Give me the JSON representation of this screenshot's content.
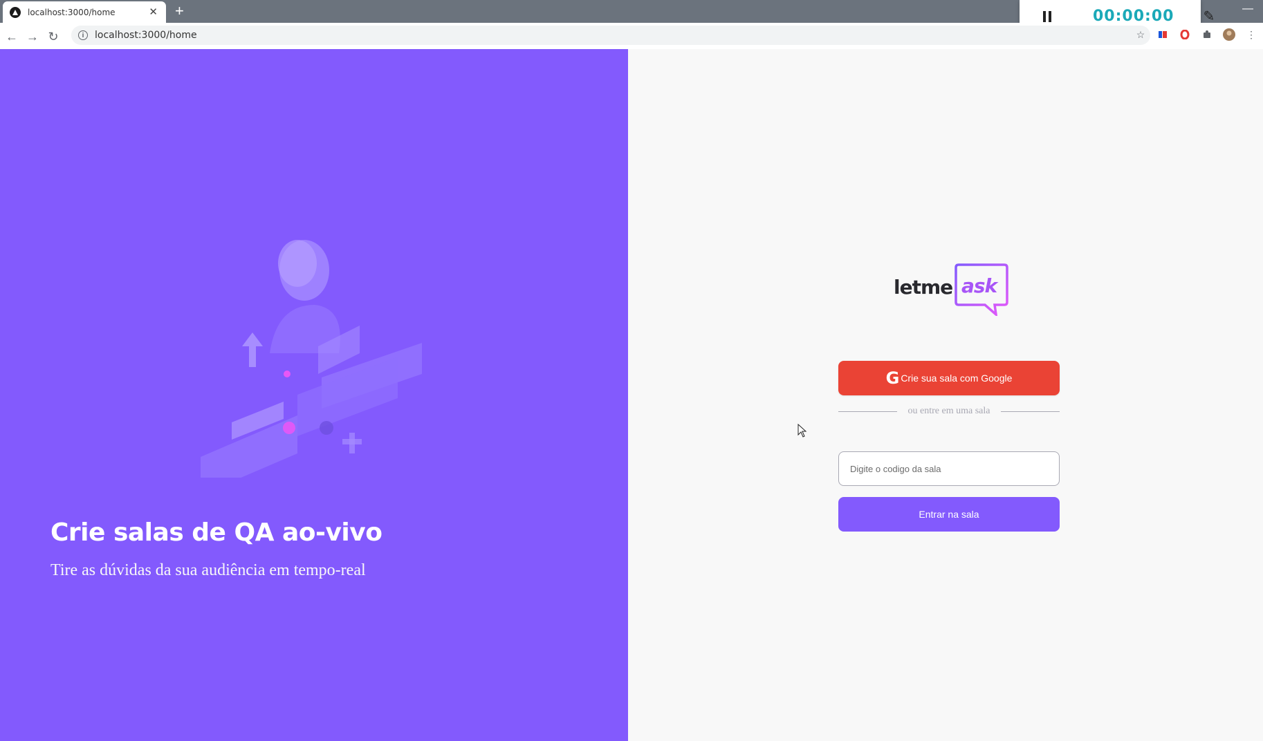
{
  "browser": {
    "tab_title": "localhost:3000/home",
    "new_tab_label": "+",
    "url": "localhost:3000/home"
  },
  "recorder": {
    "timer": "00:00:00"
  },
  "aside": {
    "title": "Crie salas de QA ao-vivo",
    "subtitle": "Tire as dúvidas da sua audiência em tempo-real"
  },
  "main": {
    "logo_text_left": "letme",
    "logo_text_right": "ask",
    "google_button": {
      "icon": "G",
      "label": "Crie sua sala com Google"
    },
    "separator": "ou entre em uma sala",
    "room_input": {
      "placeholder": "Digite o codigo da sala",
      "value": ""
    },
    "enter_button": "Entrar na sala"
  },
  "colors": {
    "brand_purple": "#835afd",
    "google_red": "#ea4335",
    "timer_teal": "#1ba9b8"
  }
}
